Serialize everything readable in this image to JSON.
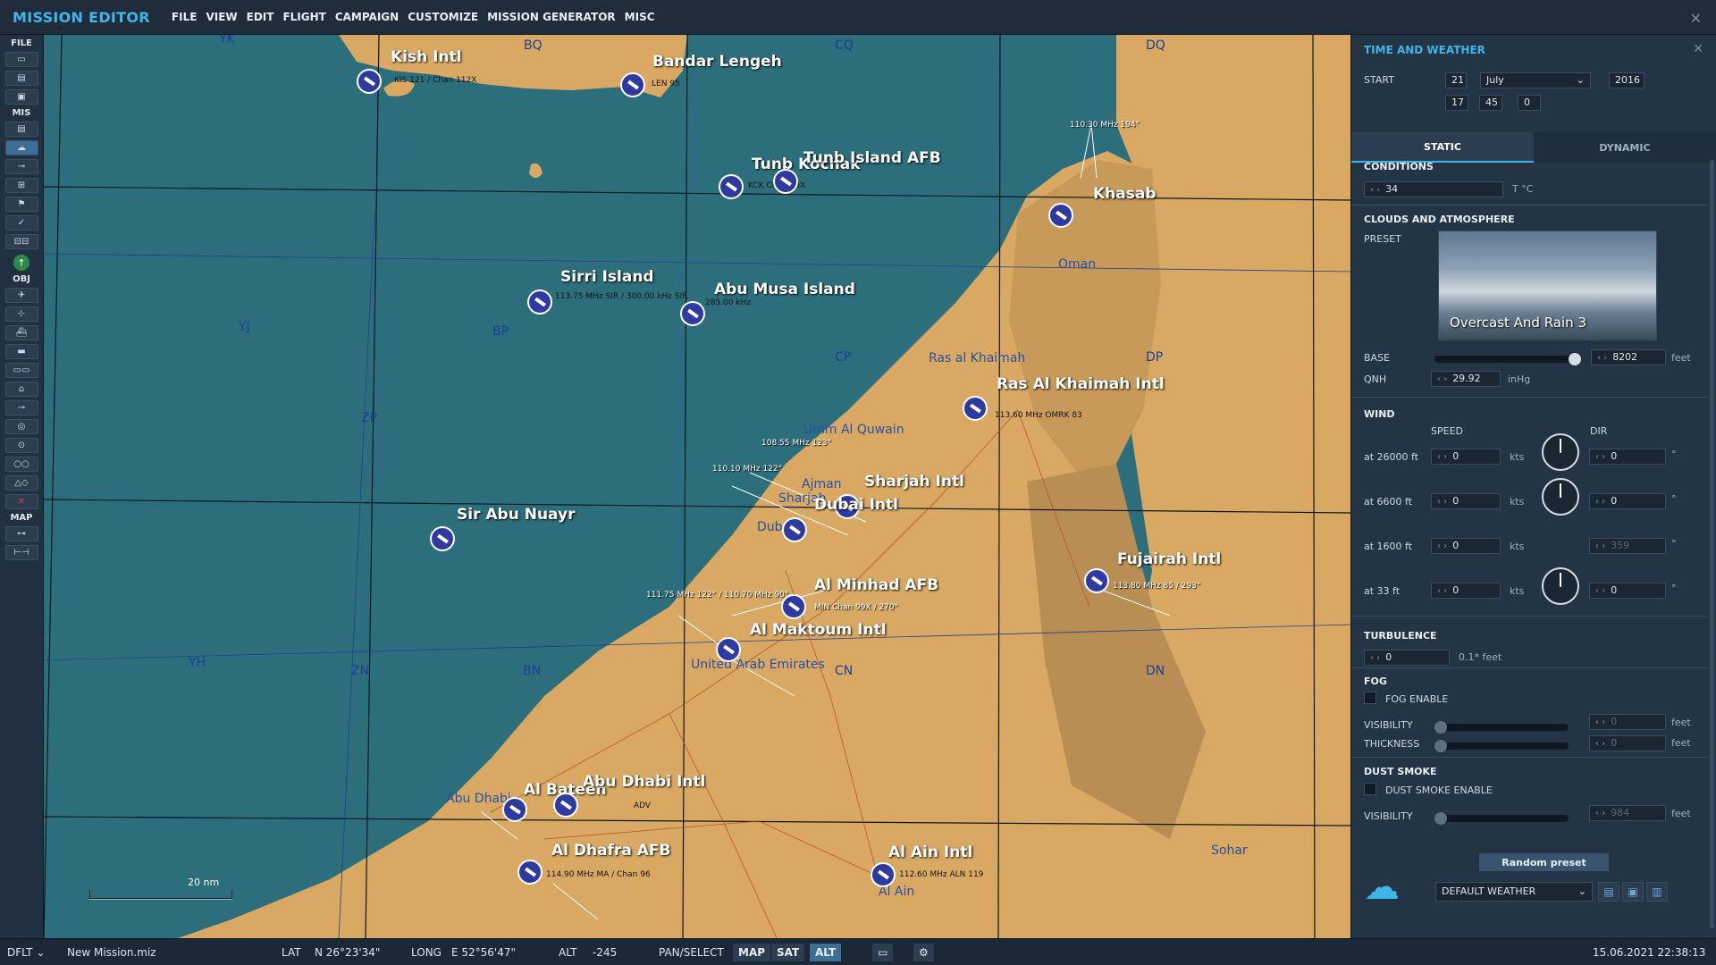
{
  "app": {
    "title": "MISSION EDITOR"
  },
  "menu": [
    "FILE",
    "VIEW",
    "EDIT",
    "FLIGHT",
    "CAMPAIGN",
    "CUSTOMIZE",
    "MISSION GENERATOR",
    "MISC"
  ],
  "toolbar": {
    "file_label": "FILE",
    "mis_label": "MIS",
    "obj_label": "OBJ",
    "map_label": "MAP"
  },
  "map": {
    "airports": [
      {
        "name": "Kish Intl",
        "freq": "KIS 121 / Chan 112X"
      },
      {
        "name": "Bandar Lengeh",
        "freq": "LEN 95"
      },
      {
        "name": "Tunb Kochak",
        "freq": "KCK Chan 89X"
      },
      {
        "name": "Tunb Island AFB",
        "freq": ""
      },
      {
        "name": "Sirri Island",
        "freq": "113.75 MHz SIR / 300.00 kHz SIR"
      },
      {
        "name": "Abu Musa Island",
        "freq": "285.00 kHz"
      },
      {
        "name": "Khasab",
        "freq": "110.30 MHz 194°"
      },
      {
        "name": "Ras Al Khaimah Intl",
        "freq": "113.60 MHz OMRK 83"
      },
      {
        "name": "Sharjah Intl",
        "freq": "108.55 MHz 123°"
      },
      {
        "name": "Dubai Intl",
        "freq": "110.10 MHz 122°"
      },
      {
        "name": "Sir Abu Nuayr",
        "freq": ""
      },
      {
        "name": "Fujairah Intl",
        "freq": "113.80 MHz 85 / 293°"
      },
      {
        "name": "Al Minhad AFB",
        "freq": "MIN Chan 99X / 270°"
      },
      {
        "name": "Al Maktoum Intl",
        "freq": "111.75 MHz 122° / 110.70 MHz 90°"
      },
      {
        "name": "Al Bateen",
        "freq": ""
      },
      {
        "name": "Abu Dhabi Intl",
        "freq": "ADV"
      },
      {
        "name": "Al Dhafra AFB",
        "freq": "114.90 MHz MA / Chan 96"
      },
      {
        "name": "Al Ain Intl",
        "freq": "112.60 MHz ALN 119"
      }
    ],
    "grid_labels": [
      "YK",
      "BQ",
      "CQ",
      "DQ",
      "YJ",
      "BP",
      "CP",
      "DP",
      "ZP",
      "YH",
      "ZN",
      "BN",
      "CN",
      "DN"
    ],
    "cities": [
      "Ras al Khaimah",
      "Umm Al Quwain",
      "Ajman",
      "Sharjah",
      "Dubai",
      "United Arab Emirates",
      "Abu Dhabi",
      "Al Ain",
      "Sohar",
      "Oman"
    ],
    "scale": "20 nm"
  },
  "panel": {
    "title": "TIME AND WEATHER",
    "start_label": "START",
    "day": "21",
    "month": "July",
    "year": "2016",
    "hour": "17",
    "minute": "45",
    "second": "0",
    "tab_static": "STATIC",
    "tab_dynamic": "DYNAMIC",
    "conditions_label": "CONDITIONS",
    "temp": "34",
    "temp_unit": "T °C",
    "clouds_label": "CLOUDS AND ATMOSPHERE",
    "preset_label": "PRESET",
    "preset_name": "Overcast And Rain 3",
    "base_label": "BASE",
    "base": "8202",
    "base_unit": "feet",
    "qnh_label": "QNH",
    "qnh": "29.92",
    "qnh_unit": "inHg",
    "wind_label": "WIND",
    "speed_label": "SPEED",
    "dir_label": "DIR",
    "wind": [
      {
        "alt": "at 26000 ft",
        "speed": "0",
        "dir": "0",
        "unit": "kts"
      },
      {
        "alt": "at 6600 ft",
        "speed": "0",
        "dir": "0",
        "unit": "kts"
      },
      {
        "alt": "at 1600 ft",
        "speed": "0",
        "dir": "359",
        "unit": "kts"
      },
      {
        "alt": "at 33 ft",
        "speed": "0",
        "dir": "0",
        "unit": "kts"
      }
    ],
    "deg": "°",
    "turbulence_label": "TURBULENCE",
    "turbulence": "0",
    "turbulence_unit": "0.1* feet",
    "fog_label": "FOG",
    "fog_enable": "FOG ENABLE",
    "visibility_label": "VISIBILITY",
    "thickness_label": "THICKNESS",
    "fog_visibility": "0",
    "fog_thickness": "0",
    "feet": "feet",
    "dust_label": "DUST SMOKE",
    "dust_enable": "DUST SMOKE ENABLE",
    "dust_visibility": "984",
    "random_preset": "Random preset",
    "weather_select": "DEFAULT WEATHER"
  },
  "status": {
    "mode": "DFLT",
    "file": "New Mission.miz",
    "lat_label": "LAT",
    "lat": "N 26°23'34\"",
    "long_label": "LONG",
    "long": "E 52°56'47\"",
    "alt_label": "ALT",
    "alt": "-245",
    "pan": "PAN/SELECT",
    "map_btn": "MAP",
    "sat_btn": "SAT",
    "alt_btn": "ALT",
    "datetime": "15.06.2021 22:38:13"
  },
  "colors": {
    "accent": "#3fb6e8",
    "sea": "#2c6e7b",
    "land": "#d9a862",
    "panel": "#233444"
  }
}
